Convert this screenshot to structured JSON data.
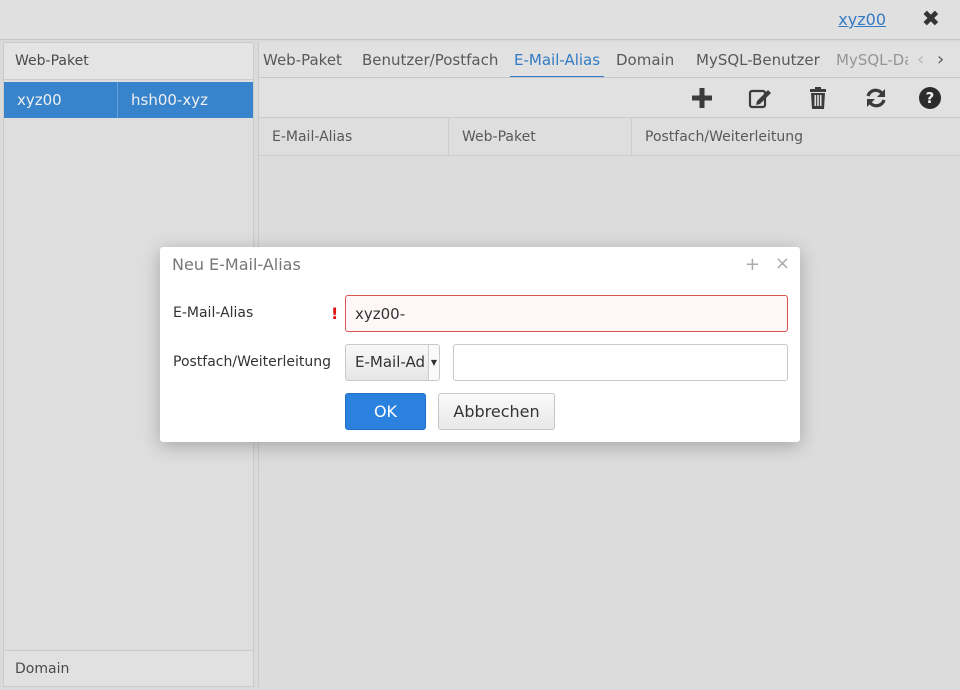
{
  "header": {
    "user_link": "xyz00",
    "close_glyph": "✖"
  },
  "sidebar": {
    "title": "Web-Paket",
    "rows": [
      {
        "name": "xyz00",
        "value": "hsh00-xyz"
      }
    ],
    "footer": "Domain"
  },
  "tabs": [
    {
      "label": "Web-Paket"
    },
    {
      "label": "Benutzer/Postfach"
    },
    {
      "label": "E-Mail-Alias",
      "active": true
    },
    {
      "label": "Domain"
    },
    {
      "label": "MySQL-Benutzer"
    },
    {
      "label": "MySQL-Da"
    }
  ],
  "tab_scroll": {
    "left": "‹",
    "right": "›"
  },
  "toolbar": {
    "icons": [
      "add-icon",
      "edit-icon",
      "delete-icon",
      "refresh-icon",
      "help-icon"
    ]
  },
  "grid": {
    "columns": [
      "E-Mail-Alias",
      "Web-Paket",
      "Postfach/Weiterleitung"
    ]
  },
  "dialog": {
    "title": "Neu E-Mail-Alias",
    "max_glyph": "+",
    "close_glyph": "×",
    "alias_label": "E-Mail-Alias",
    "required_mark": "!",
    "alias_value": "xyz00-",
    "target_label": "Postfach/Weiterleitung",
    "target_type": "E-Mail-Ad",
    "target_value": "",
    "ok_label": "OK",
    "cancel_label": "Abbrechen"
  },
  "colors": {
    "accent": "#2a82de",
    "selection": "#2e86d8",
    "error": "#d9534f"
  }
}
